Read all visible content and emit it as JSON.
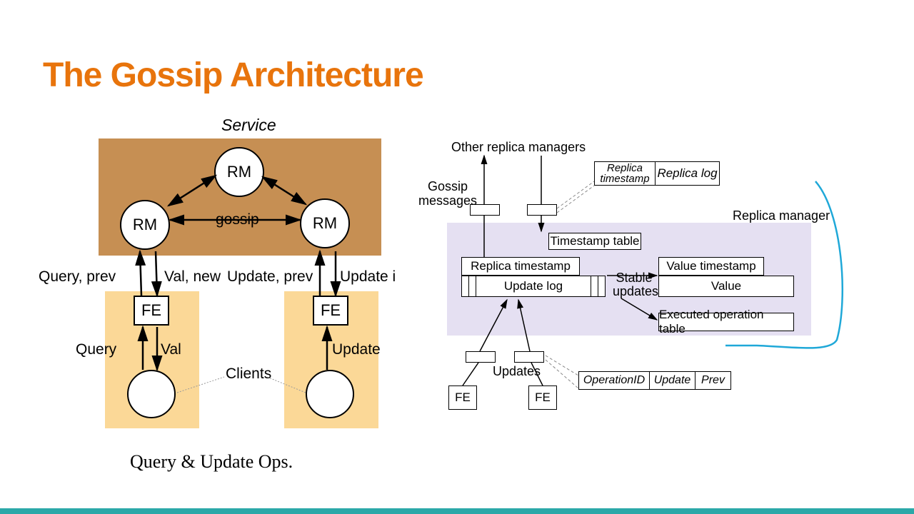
{
  "title": "The Gossip Architecture",
  "left": {
    "service": "Service",
    "rm": "RM",
    "gossip": "gossip",
    "query_prev": "Query,  prev",
    "val_new": "Val, new",
    "update_prev": "Update, prev",
    "update_i": "Update i",
    "fe": "FE",
    "query": "Query",
    "val": "Val",
    "update": "Update",
    "clients": "Clients",
    "caption": "Query & Update Ops."
  },
  "right": {
    "other_rm": "Other replica  managers",
    "gossip_messages": "Gossip messages",
    "replica_timestamp": "Replica timestamp",
    "replica_log": "Replica log",
    "replica_manager": "Replica manager",
    "timestamp_table": "Timestamp table",
    "replica_ts_box": "Replica timestamp",
    "update_log": "Update log",
    "stable_updates": "Stable updates",
    "value_timestamp": "Value timestamp",
    "value": "Value",
    "executed_op": "Executed operation table",
    "updates": "Updates",
    "fe": "FE",
    "operation_id": "OperationID",
    "update_field": "Update",
    "prev_field": "Prev"
  }
}
